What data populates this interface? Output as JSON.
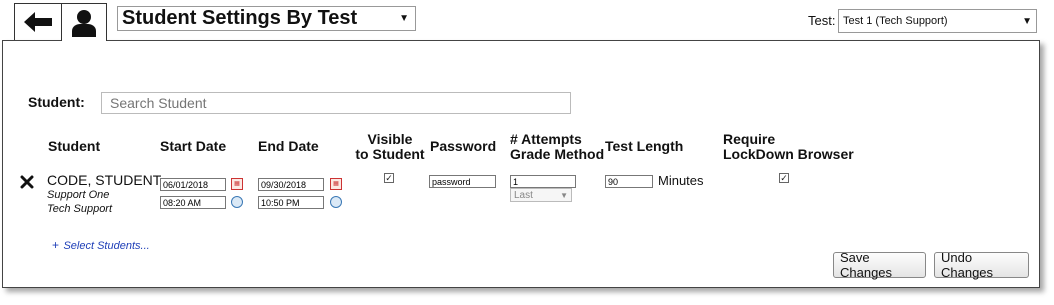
{
  "toolbar": {
    "page_title": "Student Settings By Test",
    "test_label": "Test:",
    "test_selected": "Test 1 (Tech Support)"
  },
  "search": {
    "label": "Student:",
    "placeholder": "Search Student"
  },
  "columns": {
    "student": "Student",
    "start_date": "Start Date",
    "end_date": "End Date",
    "visible_line1": "Visible",
    "visible_line2": "to Student",
    "password": "Password",
    "attempts_line1": "# Attempts",
    "attempts_line2": "Grade Method",
    "test_length": "Test Length",
    "lockdown_line1": "Require",
    "lockdown_line2": "LockDown Browser"
  },
  "row": {
    "name": "CODE, STUDENT",
    "sub1": "Support One",
    "sub2": "Tech Support",
    "start_date": "06/01/2018",
    "start_time": "08:20 AM",
    "end_date": "09/30/2018",
    "end_time": "10:50 PM",
    "visible_checked": true,
    "password": "password",
    "attempts": "1",
    "grade_method": "Last",
    "test_length": "90",
    "test_length_unit": "Minutes",
    "lockdown_checked": true
  },
  "actions": {
    "select_students": "Select Students...",
    "save": "Save Changes",
    "undo": "Undo Changes"
  }
}
